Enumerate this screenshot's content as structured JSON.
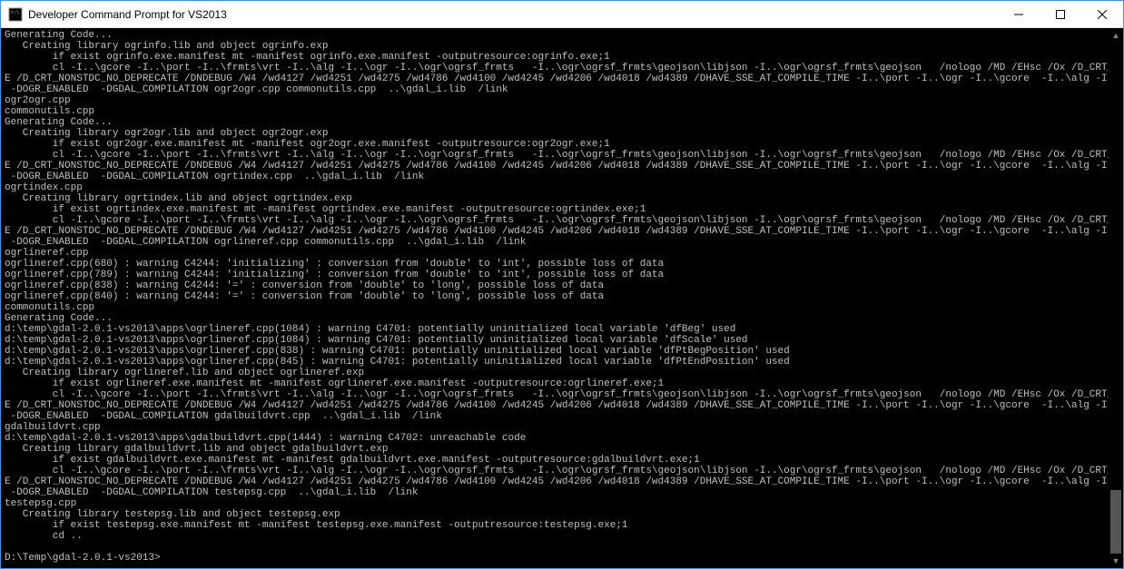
{
  "titlebar": {
    "title": "Developer Command Prompt for VS2013"
  },
  "terminal": {
    "lines": [
      "Generating Code...",
      "   Creating library ogrinfo.lib and object ogrinfo.exp",
      "        if exist ogrinfo.exe.manifest mt -manifest ogrinfo.exe.manifest -outputresource:ogrinfo.exe;1",
      "        cl -I..\\gcore -I..\\port -I..\\frmts\\vrt -I..\\alg -I..\\ogr -I..\\ogr\\ogrsf_frmts   -I..\\ogr\\ogrsf_frmts\\geojson\\libjson -I..\\ogr\\ogrsf_frmts\\geojson   /nologo /MD /EHsc /Ox /D_CRT_SECURE_NO_DEPRECAT",
      "E /D_CRT_NONSTDC_NO_DEPRECATE /DNDEBUG /W4 /wd4127 /wd4251 /wd4275 /wd4786 /wd4100 /wd4245 /wd4206 /wd4018 /wd4389 /DHAVE_SSE_AT_COMPILE_TIME -I..\\port -I..\\ogr -I..\\gcore  -I..\\alg -I..\\ogr\\ogrsf_frmts",
      " -DOGR_ENABLED  -DGDAL_COMPILATION ogr2ogr.cpp commonutils.cpp  ..\\gdal_i.lib  /link",
      "ogr2ogr.cpp",
      "commonutils.cpp",
      "Generating Code...",
      "   Creating library ogr2ogr.lib and object ogr2ogr.exp",
      "        if exist ogr2ogr.exe.manifest mt -manifest ogr2ogr.exe.manifest -outputresource:ogr2ogr.exe;1",
      "        cl -I..\\gcore -I..\\port -I..\\frmts\\vrt -I..\\alg -I..\\ogr -I..\\ogr\\ogrsf_frmts   -I..\\ogr\\ogrsf_frmts\\geojson\\libjson -I..\\ogr\\ogrsf_frmts\\geojson   /nologo /MD /EHsc /Ox /D_CRT_SECURE_NO_DEPRECAT",
      "E /D_CRT_NONSTDC_NO_DEPRECATE /DNDEBUG /W4 /wd4127 /wd4251 /wd4275 /wd4786 /wd4100 /wd4245 /wd4206 /wd4018 /wd4389 /DHAVE_SSE_AT_COMPILE_TIME -I..\\port -I..\\ogr -I..\\gcore  -I..\\alg -I..\\ogr\\ogrsf_frmts",
      " -DOGR_ENABLED  -DGDAL_COMPILATION ogrtindex.cpp  ..\\gdal_i.lib  /link",
      "ogrtindex.cpp",
      "   Creating library ogrtindex.lib and object ogrtindex.exp",
      "        if exist ogrtindex.exe.manifest mt -manifest ogrtindex.exe.manifest -outputresource:ogrtindex.exe;1",
      "        cl -I..\\gcore -I..\\port -I..\\frmts\\vrt -I..\\alg -I..\\ogr -I..\\ogr\\ogrsf_frmts   -I..\\ogr\\ogrsf_frmts\\geojson\\libjson -I..\\ogr\\ogrsf_frmts\\geojson   /nologo /MD /EHsc /Ox /D_CRT_SECURE_NO_DEPRECAT",
      "E /D_CRT_NONSTDC_NO_DEPRECATE /DNDEBUG /W4 /wd4127 /wd4251 /wd4275 /wd4786 /wd4100 /wd4245 /wd4206 /wd4018 /wd4389 /DHAVE_SSE_AT_COMPILE_TIME -I..\\port -I..\\ogr -I..\\gcore  -I..\\alg -I..\\ogr\\ogrsf_frmts",
      " -DOGR_ENABLED  -DGDAL_COMPILATION ogrlineref.cpp commonutils.cpp  ..\\gdal_i.lib  /link",
      "ogrlineref.cpp",
      "ogrlineref.cpp(680) : warning C4244: 'initializing' : conversion from 'double' to 'int', possible loss of data",
      "ogrlineref.cpp(789) : warning C4244: 'initializing' : conversion from 'double' to 'int', possible loss of data",
      "ogrlineref.cpp(838) : warning C4244: '=' : conversion from 'double' to 'long', possible loss of data",
      "ogrlineref.cpp(840) : warning C4244: '=' : conversion from 'double' to 'long', possible loss of data",
      "commonutils.cpp",
      "Generating Code...",
      "d:\\temp\\gdal-2.0.1-vs2013\\apps\\ogrlineref.cpp(1084) : warning C4701: potentially uninitialized local variable 'dfBeg' used",
      "d:\\temp\\gdal-2.0.1-vs2013\\apps\\ogrlineref.cpp(1084) : warning C4701: potentially uninitialized local variable 'dfScale' used",
      "d:\\temp\\gdal-2.0.1-vs2013\\apps\\ogrlineref.cpp(838) : warning C4701: potentially uninitialized local variable 'dfPtBegPosition' used",
      "d:\\temp\\gdal-2.0.1-vs2013\\apps\\ogrlineref.cpp(845) : warning C4701: potentially uninitialized local variable 'dfPtEndPosition' used",
      "   Creating library ogrlineref.lib and object ogrlineref.exp",
      "        if exist ogrlineref.exe.manifest mt -manifest ogrlineref.exe.manifest -outputresource:ogrlineref.exe;1",
      "        cl -I..\\gcore -I..\\port -I..\\frmts\\vrt -I..\\alg -I..\\ogr -I..\\ogr\\ogrsf_frmts   -I..\\ogr\\ogrsf_frmts\\geojson\\libjson -I..\\ogr\\ogrsf_frmts\\geojson   /nologo /MD /EHsc /Ox /D_CRT_SECURE_NO_DEPRECAT",
      "E /D_CRT_NONSTDC_NO_DEPRECATE /DNDEBUG /W4 /wd4127 /wd4251 /wd4275 /wd4786 /wd4100 /wd4245 /wd4206 /wd4018 /wd4389 /DHAVE_SSE_AT_COMPILE_TIME -I..\\port -I..\\ogr -I..\\gcore  -I..\\alg -I..\\ogr\\ogrsf_frmts",
      " -DOGR_ENABLED  -DGDAL_COMPILATION gdalbuildvrt.cpp  ..\\gdal_i.lib  /link",
      "gdalbuildvrt.cpp",
      "d:\\temp\\gdal-2.0.1-vs2013\\apps\\gdalbuildvrt.cpp(1444) : warning C4702: unreachable code",
      "   Creating library gdalbuildvrt.lib and object gdalbuildvrt.exp",
      "        if exist gdalbuildvrt.exe.manifest mt -manifest gdalbuildvrt.exe.manifest -outputresource:gdalbuildvrt.exe;1",
      "        cl -I..\\gcore -I..\\port -I..\\frmts\\vrt -I..\\alg -I..\\ogr -I..\\ogr\\ogrsf_frmts   -I..\\ogr\\ogrsf_frmts\\geojson\\libjson -I..\\ogr\\ogrsf_frmts\\geojson   /nologo /MD /EHsc /Ox /D_CRT_SECURE_NO_DEPRECAT",
      "E /D_CRT_NONSTDC_NO_DEPRECATE /DNDEBUG /W4 /wd4127 /wd4251 /wd4275 /wd4786 /wd4100 /wd4245 /wd4206 /wd4018 /wd4389 /DHAVE_SSE_AT_COMPILE_TIME -I..\\port -I..\\ogr -I..\\gcore  -I..\\alg -I..\\ogr\\ogrsf_frmts",
      " -DOGR_ENABLED  -DGDAL_COMPILATION testepsg.cpp  ..\\gdal_i.lib  /link",
      "testepsg.cpp",
      "   Creating library testepsg.lib and object testepsg.exp",
      "        if exist testepsg.exe.manifest mt -manifest testepsg.exe.manifest -outputresource:testepsg.exe;1",
      "        cd ..",
      "",
      "D:\\Temp\\gdal-2.0.1-vs2013>"
    ]
  }
}
